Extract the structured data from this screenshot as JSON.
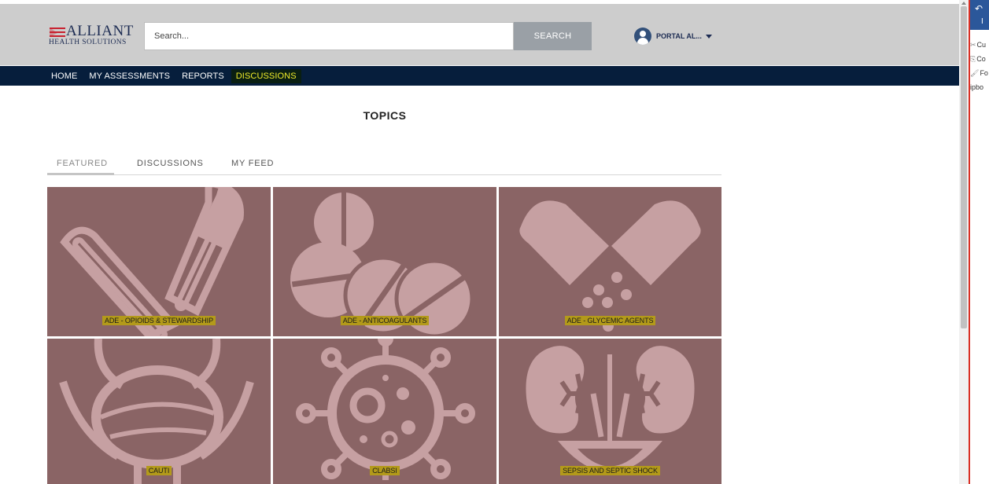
{
  "header": {
    "logo_name": "ALLIANT",
    "logo_sub": "HEALTH SOLUTIONS",
    "search_placeholder": "Search...",
    "search_button": "SEARCH",
    "user_name": "PORTAL AL..."
  },
  "nav": {
    "items": [
      "HOME",
      "MY ASSESSMENTS",
      "REPORTS",
      "DISCUSSIONS"
    ],
    "active": "DISCUSSIONS"
  },
  "page_title": "TOPICS",
  "tabs": [
    "FEATURED",
    "DISCUSSIONS",
    "MY FEED"
  ],
  "active_tab": "FEATURED",
  "tiles": [
    {
      "label": "ADE - OPIOIDS & STEWARDSHIP",
      "icon": "capsules-icon"
    },
    {
      "label": "ADE - ANTICOAGULANTS",
      "icon": "tablets-icon"
    },
    {
      "label": "ADE - GLYCEMIC AGENTS",
      "icon": "open-capsule-icon"
    },
    {
      "label": "CAUTI",
      "icon": "bladder-icon"
    },
    {
      "label": "CLABSI",
      "icon": "virus-icon"
    },
    {
      "label": "SEPSIS AND SEPTIC SHOCK",
      "icon": "kidneys-icon"
    }
  ],
  "colors": {
    "tile_bg": "#8a6465",
    "icon_fill": "#c6a0a2",
    "nav_bg": "#061e3c",
    "header_bg": "#cdcdcd",
    "highlight": "#b39a1a",
    "nav_active": "#f2ee2a"
  },
  "ribbon": {
    "undo_glyph": "↶",
    "undo_sub": "I",
    "items": [
      {
        "icon": "scissors-icon",
        "glyph": "✂",
        "text": "Cu"
      },
      {
        "icon": "copy-icon",
        "glyph": "⎘",
        "text": "Co"
      },
      {
        "icon": "format-painter-icon",
        "glyph": "🖌",
        "text": "Fo"
      },
      {
        "icon": "",
        "glyph": "",
        "text": "lipbo"
      }
    ]
  }
}
